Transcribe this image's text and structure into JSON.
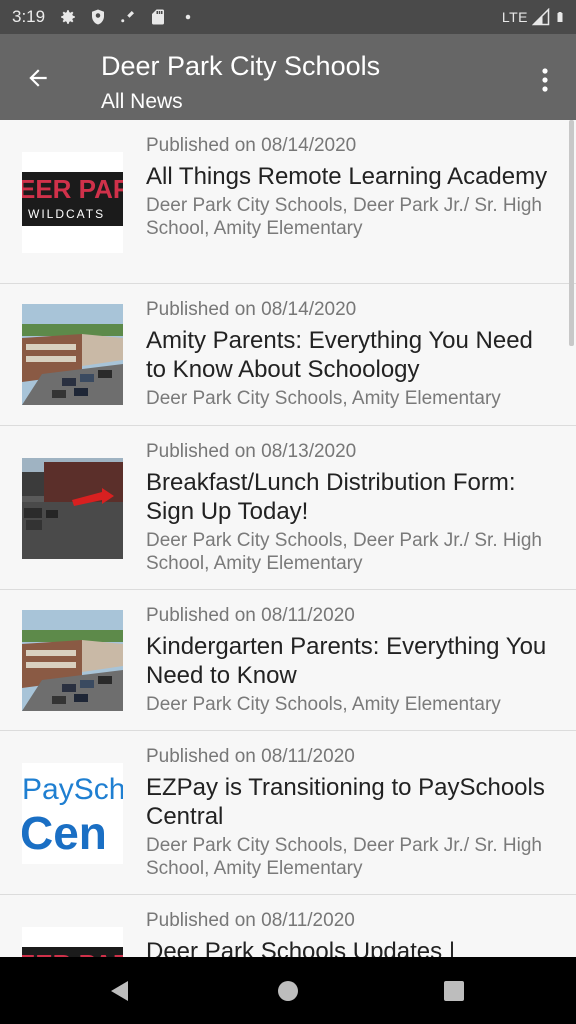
{
  "status": {
    "time": "3:19",
    "network": "LTE",
    "icons": [
      "gear-icon",
      "shield-icon",
      "signal-cast-icon",
      "sd-card-icon",
      "dot-icon"
    ]
  },
  "appbar": {
    "title": "Deer Park City Schools",
    "subtitle": "All News",
    "back_icon": "arrow-back-icon",
    "menu_icon": "more-vert-icon"
  },
  "news": [
    {
      "date": "Published on 08/14/2020",
      "headline": "All Things Remote Learning Academy",
      "schools": "Deer Park City Schools, Deer Park Jr./ Sr. High School, Amity Elementary",
      "thumb_text_top": "EER PAR",
      "thumb_text_bottom": "WILDCATS"
    },
    {
      "date": "Published on 08/14/2020",
      "headline": "Amity Parents: Everything You Need to Know About Schoology",
      "schools": "Deer Park City Schools, Amity Elementary"
    },
    {
      "date": "Published on 08/13/2020",
      "headline": "Breakfast/Lunch Distribution Form: Sign Up Today!",
      "schools": "Deer Park City Schools, Deer Park Jr./ Sr. High School, Amity Elementary"
    },
    {
      "date": "Published on 08/11/2020",
      "headline": "Kindergarten Parents: Everything You Need to Know",
      "schools": "Deer Park City Schools, Amity Elementary"
    },
    {
      "date": "Published on 08/11/2020",
      "headline": "EZPay is Transitioning to PaySchools Central",
      "schools": "Deer Park City Schools, Deer Park Jr./ Sr. High School, Amity Elementary",
      "thumb_text_top": "PaySch",
      "thumb_text_bottom": "Cen"
    },
    {
      "date": "Published on 08/11/2020",
      "headline": "Deer Park Schools Updates |",
      "schools": ""
    }
  ],
  "nav": {
    "back_icon": "nav-back-icon",
    "home_icon": "nav-home-icon",
    "recents_icon": "nav-recents-icon"
  }
}
